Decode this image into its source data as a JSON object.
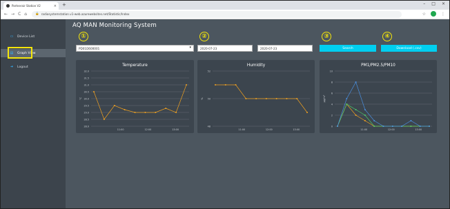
{
  "browser": {
    "tab_title": "Partnerair Station V2",
    "tab_close": "×",
    "new_tab": "+",
    "url": "radiosystemstation.v1-web.azurewebsites.net/Statistic/Index",
    "lock": "🔒",
    "back": "←",
    "forward": "→",
    "reload": "C",
    "home": "⌂",
    "minimize": "–",
    "maximize": "□",
    "close": "×",
    "star": "☆",
    "menu": "⋮"
  },
  "sidebar": {
    "items": [
      {
        "label": "Device List",
        "icon": "monitor-icon",
        "glyph": "▭"
      },
      {
        "label": "Graph View",
        "icon": "chart-icon",
        "glyph": "▤"
      },
      {
        "label": "Logout",
        "icon": "logout-icon",
        "glyph": "➜"
      }
    ]
  },
  "app_title": "AQ MAN Monitoring System",
  "markers": [
    "①",
    "②",
    "③",
    "④"
  ],
  "controls": {
    "device_value": "PD01D600001",
    "date_from": "2020-07-23",
    "date_to": "2020-07-23",
    "search_label": "Search",
    "download_label": "Download (.csv)"
  },
  "colors": {
    "accent": "#00cff0",
    "highlight": "#f5e60a",
    "orange": "#f0a020",
    "blue": "#4a90e2",
    "green": "#4cc96a",
    "panel_bg": "#3c454e"
  },
  "chart_data": [
    {
      "type": "line",
      "title": "Temperature",
      "ylabel": "°C",
      "x_ticks": [
        "11:00",
        "12:00",
        "13:00"
      ],
      "y_ticks": [
        "28.0",
        "28.5",
        "29.0",
        "29.5",
        "30.0",
        "30.5",
        "31.0",
        "31.5",
        "32.0"
      ],
      "ylim": [
        28.0,
        32.0
      ],
      "series": [
        {
          "values": [
            30.5,
            28.5,
            29.5,
            29.2,
            29.0,
            29.0,
            29.0,
            29.3,
            29.0,
            31.0
          ]
        }
      ]
    },
    {
      "type": "line",
      "title": "Humidity",
      "ylabel": "%",
      "x_ticks": [
        "11:00",
        "12:00",
        "13:00"
      ],
      "y_ticks": [
        "48",
        "50",
        "52"
      ],
      "ylim": [
        48,
        52
      ],
      "series": [
        {
          "values": [
            51,
            51,
            51,
            50,
            50,
            50,
            50,
            50,
            50,
            49
          ]
        }
      ]
    },
    {
      "type": "line",
      "title": "PM1/PM2.5/PM10",
      "ylabel": "µg/m³",
      "x_ticks": [
        "11:00",
        "12:00",
        "13:00"
      ],
      "y_ticks": [
        "0",
        "2",
        "4",
        "6",
        "8",
        "10"
      ],
      "ylim": [
        0,
        10
      ],
      "series": [
        {
          "values": [
            0,
            4,
            2,
            1,
            0,
            0,
            0,
            0,
            0,
            0,
            0
          ]
        },
        {
          "values": [
            0,
            4,
            3,
            2,
            0,
            0,
            0,
            0,
            0,
            0,
            0
          ]
        },
        {
          "values": [
            0,
            5,
            8,
            3,
            1,
            0,
            0,
            0,
            1,
            0,
            0
          ]
        }
      ]
    }
  ]
}
